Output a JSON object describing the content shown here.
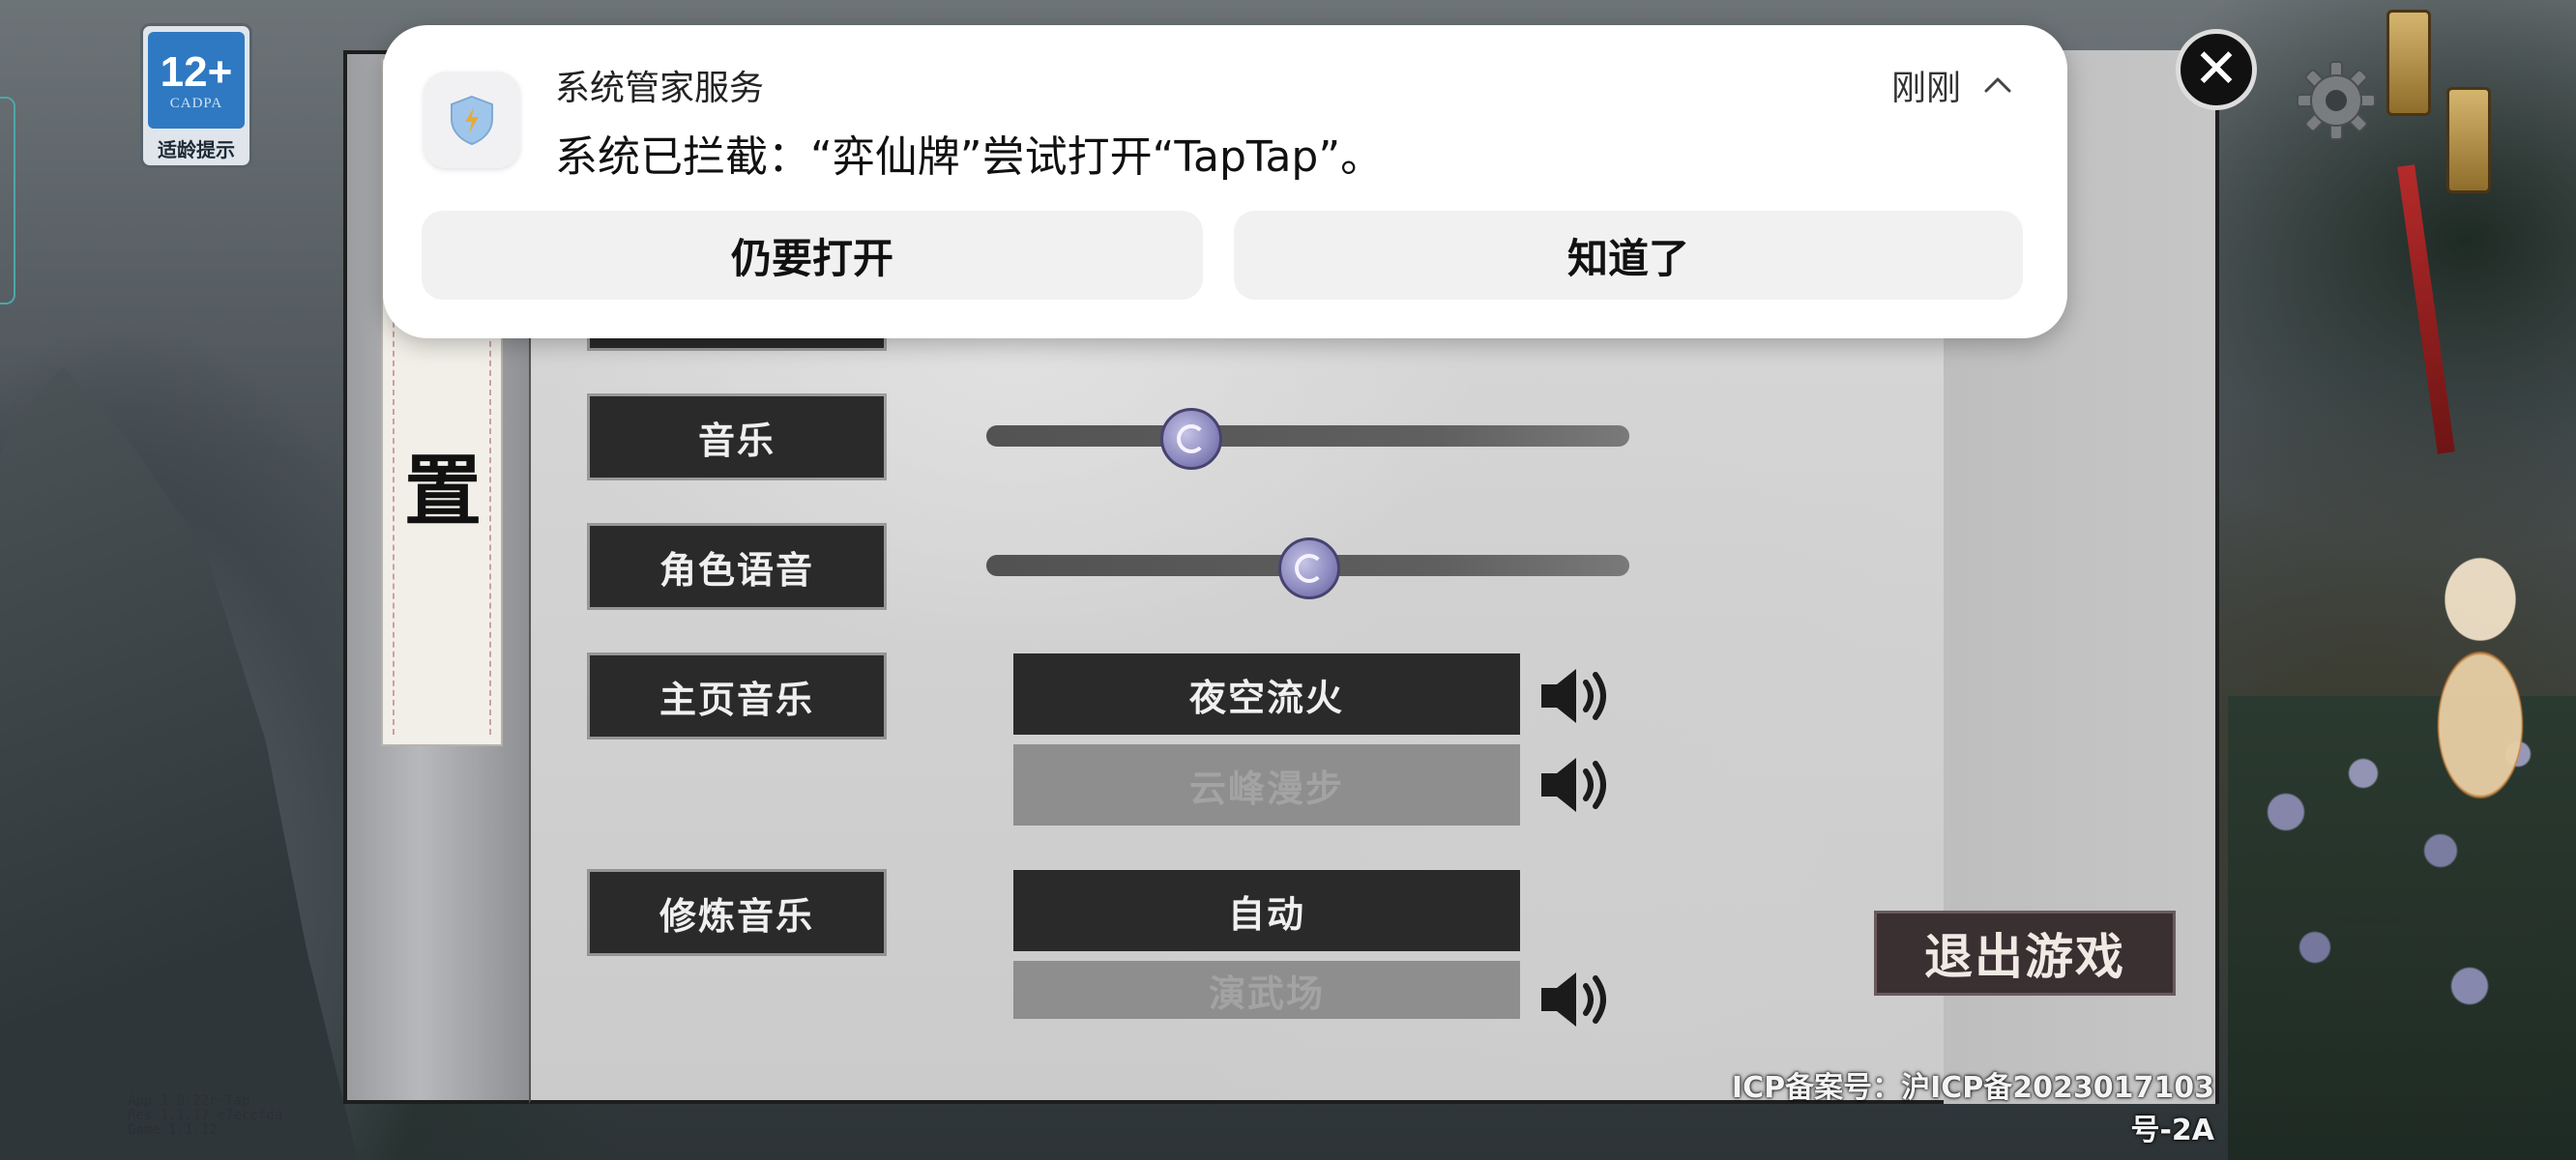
{
  "notification": {
    "app_name": "系统管家服务",
    "time": "刚刚",
    "message": "系统已拦截：“弈仙牌”尝试打开“TapTap”。",
    "buttons": {
      "open_anyway": "仍要打开",
      "got_it": "知道了"
    },
    "icon": "shield-lightning-icon",
    "collapse_icon": "chevron-up-icon"
  },
  "age_badge": {
    "rating": "12+",
    "org": "CADPA",
    "tip": "适龄提示"
  },
  "version_lines": [
    "App 1.0.22r-Tap",
    "Res 1.1.17 e7eccfda",
    "Game 1.1.12"
  ],
  "settings": {
    "side_char": "置",
    "rows": {
      "music": {
        "label": "音乐",
        "level": 0.31
      },
      "voice": {
        "label": "角色语音",
        "level": 0.5
      },
      "home_music": {
        "label": "主页音乐",
        "options": [
          "夜空流火",
          "云峰漫步"
        ],
        "selected": "夜空流火"
      },
      "train_music": {
        "label": "修炼音乐",
        "options": [
          "自动",
          "演武场"
        ],
        "selected": "自动"
      }
    },
    "exit_button": "退出游戏",
    "icp": "ICP备案号：沪ICP备2023017103号-2A"
  },
  "top_controls": {
    "close_icon": "close-icon",
    "settings_icon": "gear-icon"
  },
  "colors": {
    "accent_blue": "#2f79c2",
    "notif_bg": "#ffffff",
    "button_dark": "#2a2a2a"
  }
}
